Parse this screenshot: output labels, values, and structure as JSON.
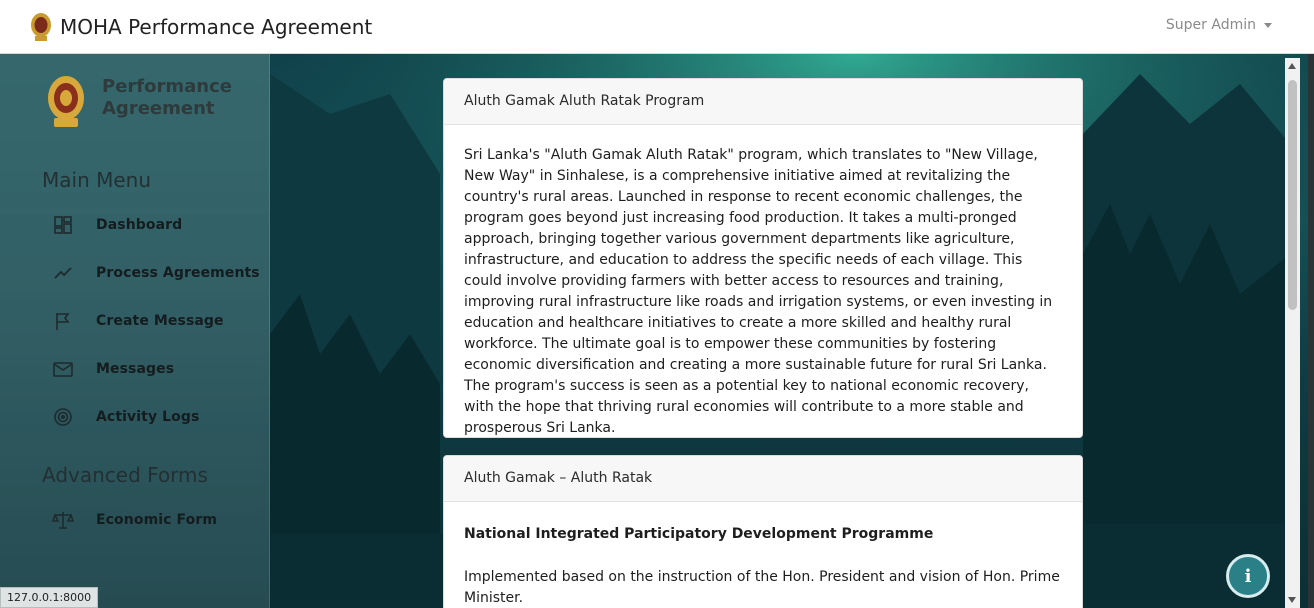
{
  "topbar": {
    "title": "MOHA Performance Agreement",
    "user": "Super Admin"
  },
  "sidebar": {
    "brand": "Performance Agreement",
    "sections": [
      {
        "title": "Main Menu"
      },
      {
        "title": "Advanced Forms"
      }
    ],
    "items": [
      {
        "label": "Dashboard",
        "icon": "dashboard-icon"
      },
      {
        "label": "Process Agreements",
        "icon": "trend-line-icon"
      },
      {
        "label": "Create Message",
        "icon": "flag-icon"
      },
      {
        "label": "Messages",
        "icon": "envelope-icon"
      },
      {
        "label": "Activity Logs",
        "icon": "target-icon"
      },
      {
        "label": "Economic Form",
        "icon": "scale-icon"
      }
    ]
  },
  "cards": [
    {
      "header": "Aluth Gamak Aluth Ratak Program",
      "body": "Sri Lanka's \"Aluth Gamak Aluth Ratak\" program, which translates to \"New Village, New Way\" in Sinhalese, is a comprehensive initiative aimed at revitalizing the country's rural areas. Launched in response to recent economic challenges, the program goes beyond just increasing food production. It takes a multi-pronged approach, bringing together various government departments like agriculture, infrastructure, and education to address the specific needs of each village. This could involve providing farmers with better access to resources and training, improving rural infrastructure like roads and irrigation systems, or even investing in education and healthcare initiatives to create a more skilled and healthy rural workforce. The ultimate goal is to empower these communities by fostering economic diversification and creating a more sustainable future for rural Sri Lanka. The program's success is seen as a potential key to national economic recovery, with the hope that thriving rural economies will contribute to a more stable and prosperous Sri Lanka."
    },
    {
      "header": "Aluth Gamak – Aluth Ratak",
      "subhead": "National Integrated Participatory Development Programme",
      "body": "Implemented based on the instruction of the Hon. President and vision of Hon. Prime Minister."
    }
  ],
  "status_url": "127.0.0.1:8000",
  "info_button": "i",
  "colors": {
    "sidebar_bg": "#3c6e73",
    "fab": "#2b7f86",
    "card_header": "#f7f7f7"
  }
}
